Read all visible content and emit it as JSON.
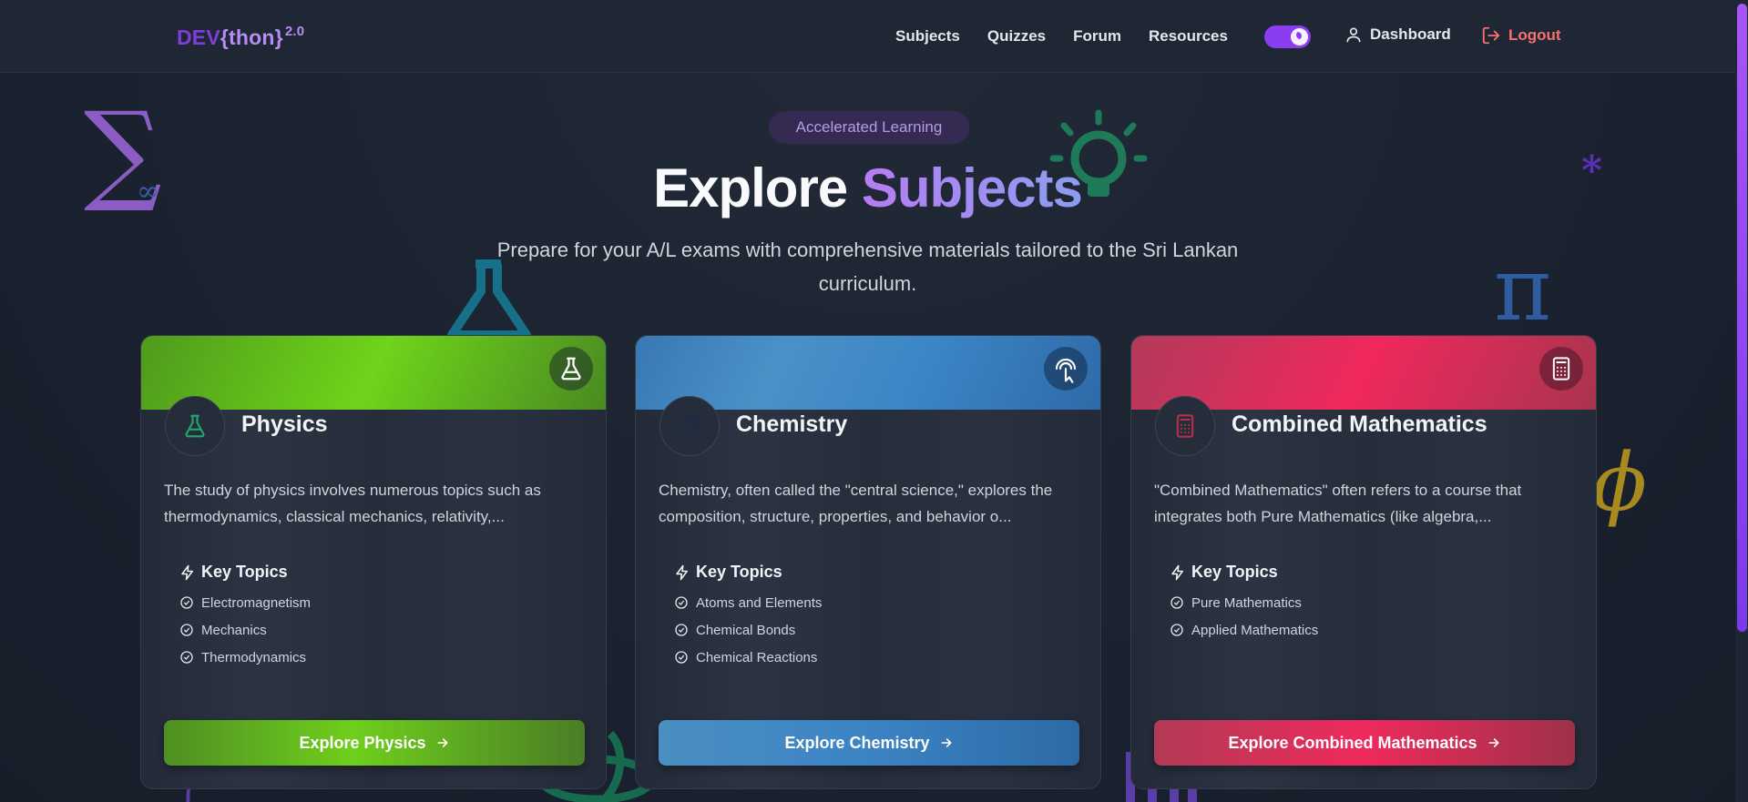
{
  "nav": {
    "logo": {
      "prefix": "DEV",
      "main": "{thon}",
      "version": "2.0"
    },
    "links": [
      "Subjects",
      "Quizzes",
      "Forum",
      "Resources"
    ],
    "dashboard_label": "Dashboard",
    "logout_label": "Logout",
    "theme_toggle_on": true
  },
  "hero": {
    "badge": "Accelerated Learning",
    "title_main": "Explore",
    "title_accent": "Subjects",
    "subtitle": "Prepare for your A/L exams with comprehensive materials tailored to the Sri Lankan curriculum."
  },
  "colors": {
    "brand": "#8b3df0",
    "physics": "#5fb81a",
    "chemistry": "#3b82c4",
    "maths": "#e11d48"
  },
  "subjects": [
    {
      "name": "Physics",
      "icon": "flask-icon",
      "description": "The study of physics involves numerous topics such as thermodynamics, classical mechanics, relativity,...",
      "key_topics_label": "Key Topics",
      "topics": [
        "Electromagnetism",
        "Mechanics",
        "Thermodynamics"
      ],
      "button_label": "Explore Physics"
    },
    {
      "name": "Chemistry",
      "icon": "pointer-click-icon",
      "description": "Chemistry, often called the \"central science,\" explores the composition, structure, properties, and behavior o...",
      "key_topics_label": "Key Topics",
      "topics": [
        "Atoms and Elements",
        "Chemical Bonds",
        "Chemical Reactions"
      ],
      "button_label": "Explore Chemistry"
    },
    {
      "name": "Combined Mathematics",
      "icon": "calculator-icon",
      "description": "\"Combined Mathematics\" often refers to a course that integrates both Pure Mathematics (like algebra,...",
      "key_topics_label": "Key Topics",
      "topics": [
        "Pure Mathematics",
        "Applied Mathematics"
      ],
      "button_label": "Explore Combined Mathematics"
    }
  ]
}
